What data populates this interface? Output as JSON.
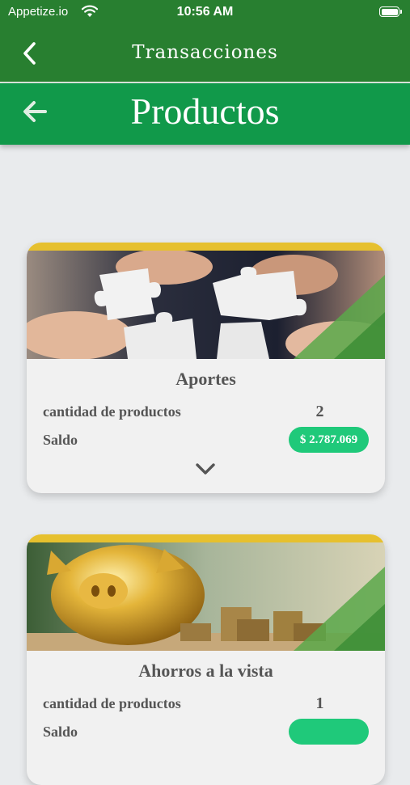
{
  "status_bar": {
    "carrier": "Appetize.io",
    "time": "10:56 AM"
  },
  "nav": {
    "title": "Transacciones",
    "back_icon": "chevron-left-icon"
  },
  "header": {
    "title": "Productos",
    "back_icon": "arrow-left-icon"
  },
  "colors": {
    "nav_green": "#287f30",
    "header_green": "#11994a",
    "card_band_yellow": "#e6c02e",
    "badge_green": "#1fc97a"
  },
  "cards": [
    {
      "title": "Aportes",
      "count_label": "cantidad de productos",
      "count_value": "2",
      "balance_label": "Saldo",
      "balance_value": "$ 2.787.069",
      "image": "puzzle-pieces-hands"
    },
    {
      "title": "Ahorros a la vista",
      "count_label": "cantidad de productos",
      "count_value": "1",
      "balance_label": "Saldo",
      "image": "golden-piggy-bank-coins"
    }
  ]
}
